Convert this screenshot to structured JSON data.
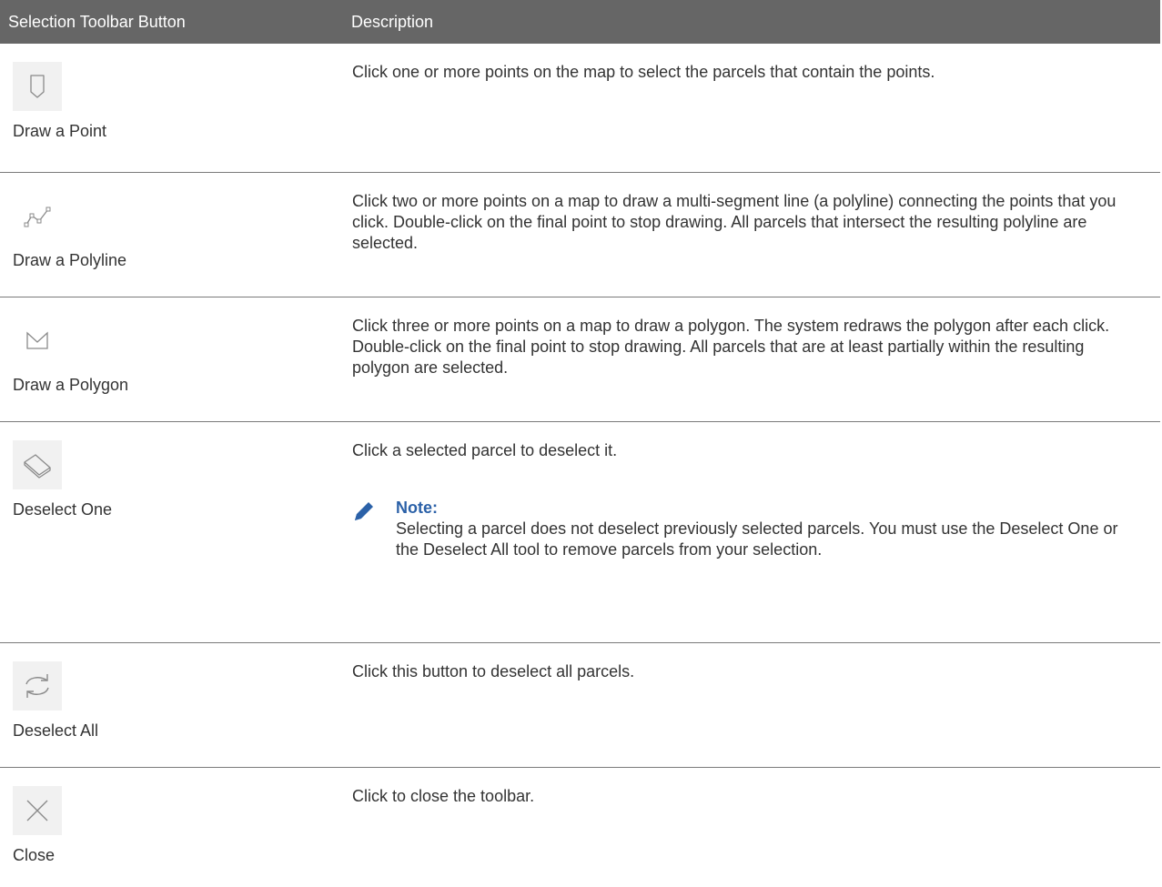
{
  "header": {
    "col1": "Selection Toolbar Button",
    "col2": "Description"
  },
  "rows": [
    {
      "label": "Draw a Point",
      "icon": "point-icon",
      "desc": "Click one or more points on the map to select the parcels that contain the points."
    },
    {
      "label": "Draw a Polyline",
      "icon": "polyline-icon",
      "desc": "Click two or more points on a map to draw a multi-segment line (a polyline) connecting the points that you click. Double-click on the final point to stop drawing. All parcels that intersect the resulting polyline are selected."
    },
    {
      "label": "Draw a Polygon",
      "icon": "polygon-icon",
      "desc": "Click three or more points on a map to draw a polygon. The system redraws the polygon after each click. Double-click on the final point to stop drawing. All parcels that are at least partially within the resulting polygon are selected."
    },
    {
      "label": "Deselect One",
      "icon": "eraser-icon",
      "desc": "Click a selected parcel to deselect it.",
      "note_title": "Note:",
      "note_text": "Selecting a parcel does not deselect previously selected parcels. You must use the Deselect One or the Deselect All tool to remove parcels from your selection."
    },
    {
      "label": "Deselect All",
      "icon": "refresh-icon",
      "desc": "Click this button to deselect all parcels."
    },
    {
      "label": "Close",
      "icon": "close-icon",
      "desc": "Click to close the toolbar."
    }
  ],
  "colors": {
    "header_bg": "#666666",
    "note_title": "#2b61a8",
    "icon_bg": "#f1f1f1"
  }
}
